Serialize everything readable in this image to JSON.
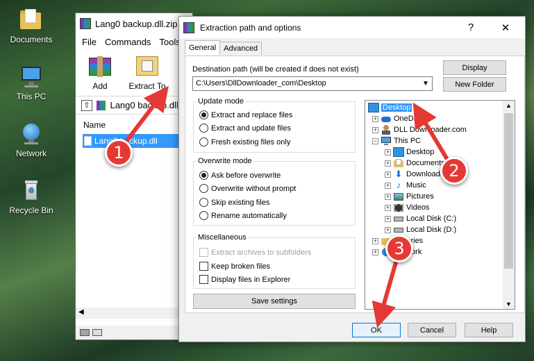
{
  "desktop": {
    "icons": [
      {
        "label": "Documents",
        "icon": "folder-documents-icon"
      },
      {
        "label": "This PC",
        "icon": "computer-icon"
      },
      {
        "label": "Network",
        "icon": "network-icon"
      },
      {
        "label": "Recycle Bin",
        "icon": "recycle-bin-icon"
      }
    ]
  },
  "winrar": {
    "title": "Lang0 backup.dll.zip",
    "menu": [
      "File",
      "Commands",
      "Tools"
    ],
    "toolbar": {
      "add_label": "Add",
      "extract_label": "Extract To"
    },
    "address": "Lang0 backup.dll.zip",
    "column_name": "Name",
    "file_row": "Lang0 backup.dll"
  },
  "dialog": {
    "title": "Extraction path and options",
    "help_glyph": "?",
    "close_glyph": "✕",
    "tabs": [
      "General",
      "Advanced"
    ],
    "dest_label": "Destination path (will be created if does not exist)",
    "dest_value": "C:\\Users\\DllDownloader_com\\Desktop",
    "display_button": "Display",
    "new_folder_button": "New Folder",
    "update_mode": {
      "title": "Update mode",
      "options": [
        "Extract and replace files",
        "Extract and update files",
        "Fresh existing files only"
      ]
    },
    "overwrite_mode": {
      "title": "Overwrite mode",
      "options": [
        "Ask before overwrite",
        "Overwrite without prompt",
        "Skip existing files",
        "Rename automatically"
      ]
    },
    "misc": {
      "title": "Miscellaneous",
      "options": [
        "Extract archives to subfolders",
        "Keep broken files",
        "Display files in Explorer"
      ]
    },
    "save_settings": "Save settings",
    "tree": [
      "Desktop",
      "OneDrive",
      "DLL Downloader.com",
      "This PC",
      "Desktop",
      "Documents",
      "Downloads",
      "Music",
      "Pictures",
      "Videos",
      "Local Disk (C:)",
      "Local Disk (D:)",
      "Libraries",
      "Network"
    ],
    "ok_button": "OK",
    "cancel_button": "Cancel",
    "help_button": "Help"
  },
  "annotations": {
    "badges": [
      "1",
      "2",
      "3"
    ],
    "color": "#e53935"
  },
  "colors": {
    "selection": "#3399ff",
    "ok_border": "#0078d7"
  }
}
